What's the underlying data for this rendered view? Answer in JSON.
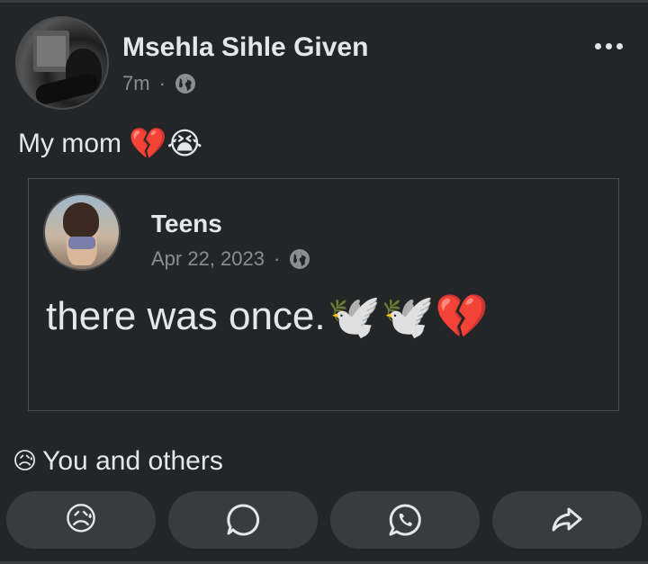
{
  "post": {
    "author": "Msehla Sihle Given",
    "time": "7m",
    "separator": "·",
    "text": "My mom",
    "text_emojis": "💔😭",
    "privacy_icon": "globe-icon"
  },
  "shared_post": {
    "author": "Teens",
    "date": "Apr 22, 2023",
    "separator": "·",
    "text": "there was once.",
    "text_emojis": "🕊️🕊️💔",
    "privacy_icon": "globe-icon"
  },
  "reactions": {
    "emoji": "😥",
    "summary": "You and others"
  },
  "actions": [
    {
      "name": "react",
      "icon": "sad-emoji",
      "emoji": "😥"
    },
    {
      "name": "comment",
      "icon": "comment-icon"
    },
    {
      "name": "whatsapp",
      "icon": "whatsapp-icon"
    },
    {
      "name": "share",
      "icon": "share-icon"
    }
  ],
  "colors": {
    "background": "#242526",
    "text": "#e4e6eb",
    "muted": "#8a8d91",
    "button": "#3a3b3c"
  }
}
